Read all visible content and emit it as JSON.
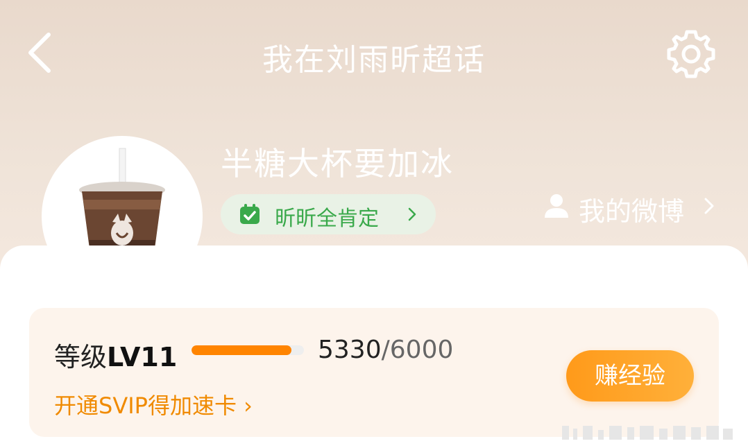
{
  "header": {
    "title": "我在刘雨昕超话"
  },
  "profile": {
    "username": "半糖大杯要加冰",
    "badge_label": "昕昕全肯定",
    "weibo_link_label": "我的微博"
  },
  "level": {
    "label": "等级",
    "level_value": "LV11",
    "exp_current": "5330",
    "exp_separator": "/",
    "exp_max": "6000",
    "progress_fraction": 0.888,
    "svip_link": "开通SVIP得加速卡 ›",
    "earn_button": "赚经验"
  },
  "colors": {
    "accent_orange": "#ff8400",
    "badge_green": "#3aa94b"
  },
  "icons": [
    "back-icon",
    "settings-gear-icon",
    "calendar-check-icon",
    "person-icon",
    "chevron-right-icon"
  ]
}
